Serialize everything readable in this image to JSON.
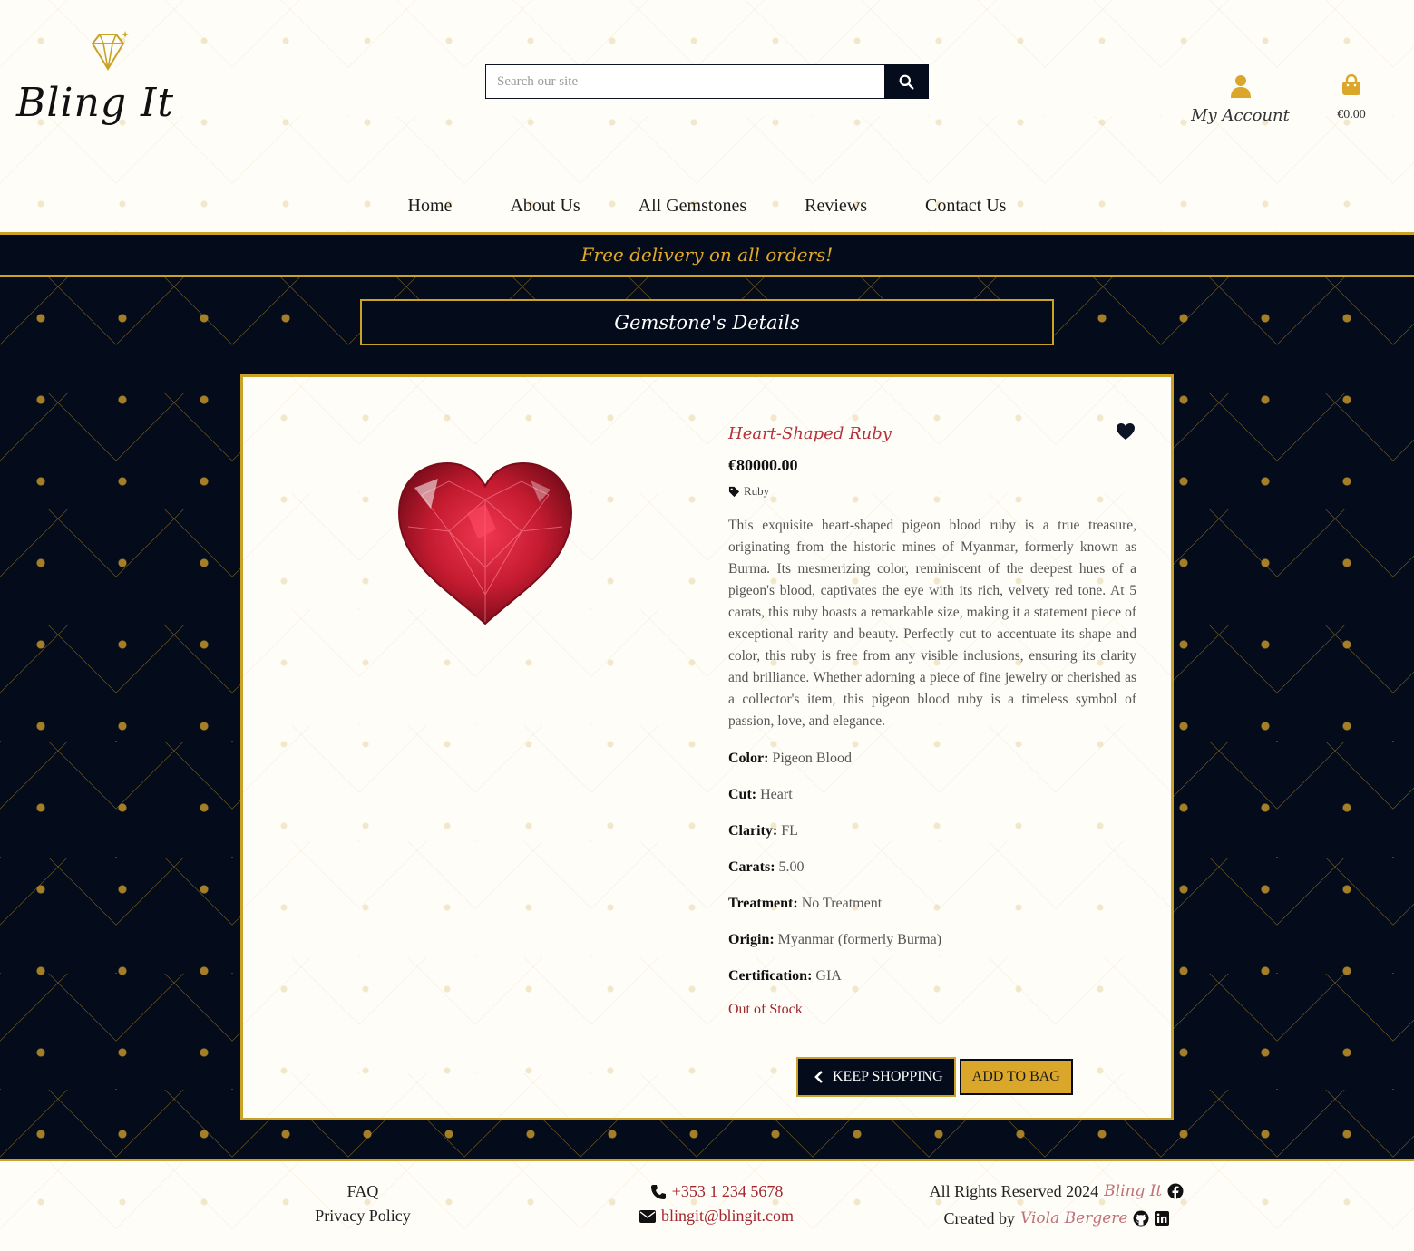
{
  "brand": {
    "name": "Bling It"
  },
  "search": {
    "placeholder": "Search our site"
  },
  "account": {
    "label": "My Account"
  },
  "bag": {
    "total": "€0.00"
  },
  "nav": [
    "Home",
    "About Us",
    "All Gemstones",
    "Reviews",
    "Contact Us"
  ],
  "banner": "Free delivery on all orders!",
  "page_heading": "Gemstone's Details",
  "product": {
    "name": "Heart-Shaped Ruby",
    "price": "€80000.00",
    "category": "Ruby",
    "description": "This exquisite heart-shaped pigeon blood ruby is a true treasure, originating from the historic mines of Myanmar, formerly known as Burma. Its mesmerizing color, reminiscent of the deepest hues of a pigeon's blood, captivates the eye with its rich, velvety red tone. At 5 carats, this ruby boasts a remarkable size, making it a statement piece of exceptional rarity and beauty. Perfectly cut to accentuate its shape and color, this ruby is free from any visible inclusions, ensuring its clarity and brilliance. Whether adorning a piece of fine jewelry or cherished as a collector's item, this pigeon blood ruby is a timeless symbol of passion, love, and elegance.",
    "specs": [
      {
        "label": "Color:",
        "value": "Pigeon Blood"
      },
      {
        "label": "Cut:",
        "value": "Heart"
      },
      {
        "label": "Clarity:",
        "value": "FL"
      },
      {
        "label": "Carats:",
        "value": "5.00"
      },
      {
        "label": "Treatment:",
        "value": "No Treatment"
      },
      {
        "label": "Origin:",
        "value": "Myanmar (formerly Burma)"
      },
      {
        "label": "Certification:",
        "value": "GIA"
      }
    ],
    "stock_status": "Out of Stock"
  },
  "buttons": {
    "keep_shopping": "KEEP SHOPPING",
    "add_to_bag": "ADD TO BAG"
  },
  "footer": {
    "faq": "FAQ",
    "privacy": "Privacy Policy",
    "phone": "+353 1 234 5678",
    "email": "blingit@blingit.com",
    "rights": "All Rights Reserved 2024",
    "rights_brand": "Bling It",
    "created_by": "Created by",
    "author": "Viola Bergere"
  },
  "colors": {
    "gold": "#c9a227",
    "navy": "#040b1a",
    "ruby": "#a3262e"
  }
}
